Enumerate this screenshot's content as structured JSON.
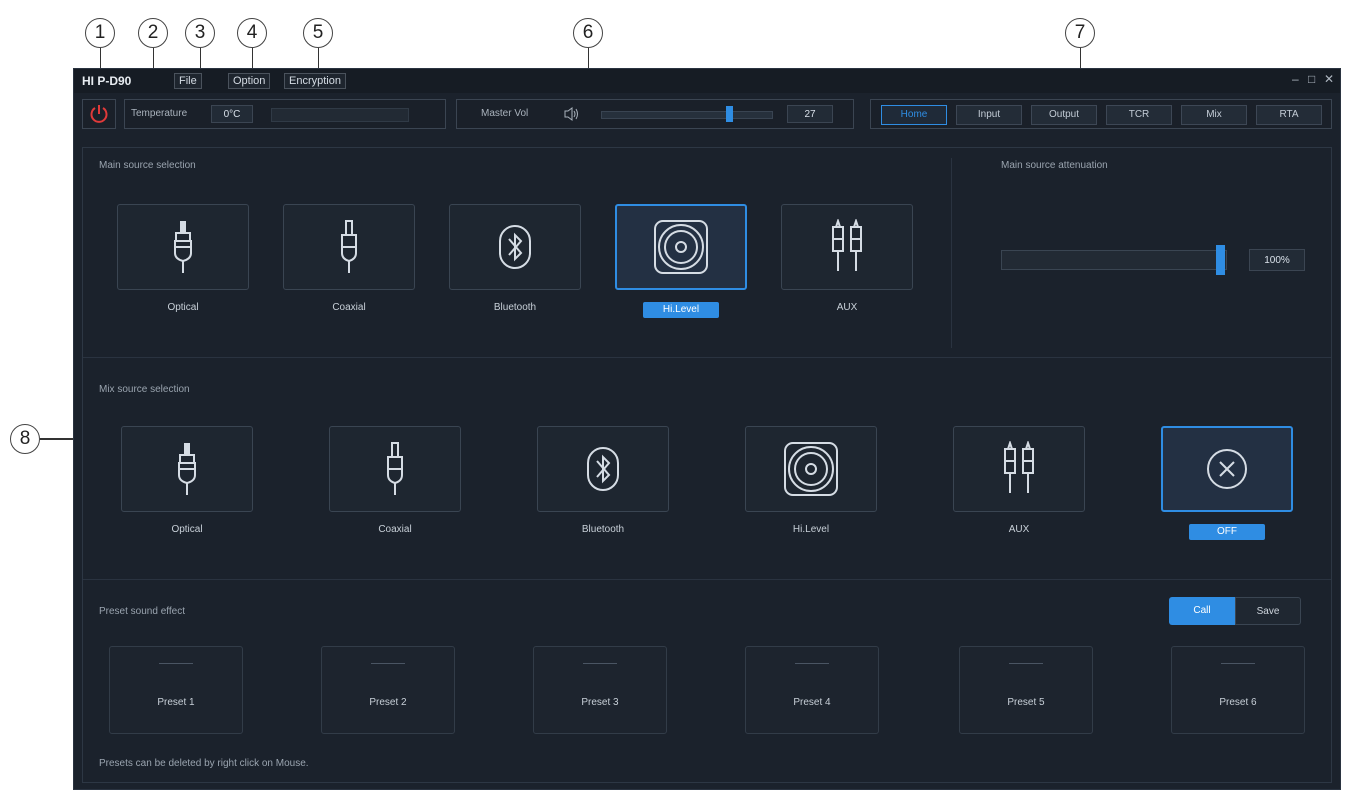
{
  "callouts": [
    "1",
    "2",
    "3",
    "4",
    "5",
    "6",
    "7",
    "8"
  ],
  "window": {
    "title": "HI P-D90",
    "menu": {
      "file": "File",
      "option": "Option",
      "encryption": "Encryption"
    },
    "controls": {
      "minimize": "–",
      "maximize": "□",
      "close": "✕"
    }
  },
  "toolbar": {
    "power_icon": "power-icon",
    "temperature": {
      "label": "Temperature",
      "value": "0°C"
    },
    "master_vol": {
      "label": "Master Vol",
      "value": "27",
      "level_percent": 75
    },
    "nav": [
      {
        "label": "Home",
        "active": true
      },
      {
        "label": "Input",
        "active": false
      },
      {
        "label": "Output",
        "active": false
      },
      {
        "label": "TCR",
        "active": false
      },
      {
        "label": "Mix",
        "active": false
      },
      {
        "label": "RTA",
        "active": false
      }
    ]
  },
  "main_source": {
    "title": "Main source selection",
    "items": [
      {
        "label": "Optical",
        "icon": "optical-icon"
      },
      {
        "label": "Coaxial",
        "icon": "coaxial-icon"
      },
      {
        "label": "Bluetooth",
        "icon": "bluetooth-icon"
      },
      {
        "label": "Hi.Level",
        "icon": "speaker-icon",
        "selected": true
      },
      {
        "label": "AUX",
        "icon": "rca-icon"
      }
    ]
  },
  "attenuation": {
    "title": "Main source attenuation",
    "value": "100%",
    "level_percent": 100
  },
  "mix_source": {
    "title": "Mix  source selection",
    "items": [
      {
        "label": "Optical",
        "icon": "optical-icon"
      },
      {
        "label": "Coaxial",
        "icon": "coaxial-icon"
      },
      {
        "label": "Bluetooth",
        "icon": "bluetooth-icon"
      },
      {
        "label": "Hi.Level",
        "icon": "speaker-icon"
      },
      {
        "label": "AUX",
        "icon": "rca-icon"
      },
      {
        "label": "OFF",
        "icon": "close-circle-icon",
        "selected": true
      }
    ]
  },
  "preset": {
    "title": "Preset sound effect",
    "call": "Call",
    "save": "Save",
    "items": [
      "Preset 1",
      "Preset 2",
      "Preset 3",
      "Preset 4",
      "Preset 5",
      "Preset 6"
    ],
    "note": "Presets can be deleted by right click on Mouse."
  },
  "colors": {
    "accent": "#2f8de3",
    "background": "#1b222c",
    "power": "#e03a3a"
  }
}
